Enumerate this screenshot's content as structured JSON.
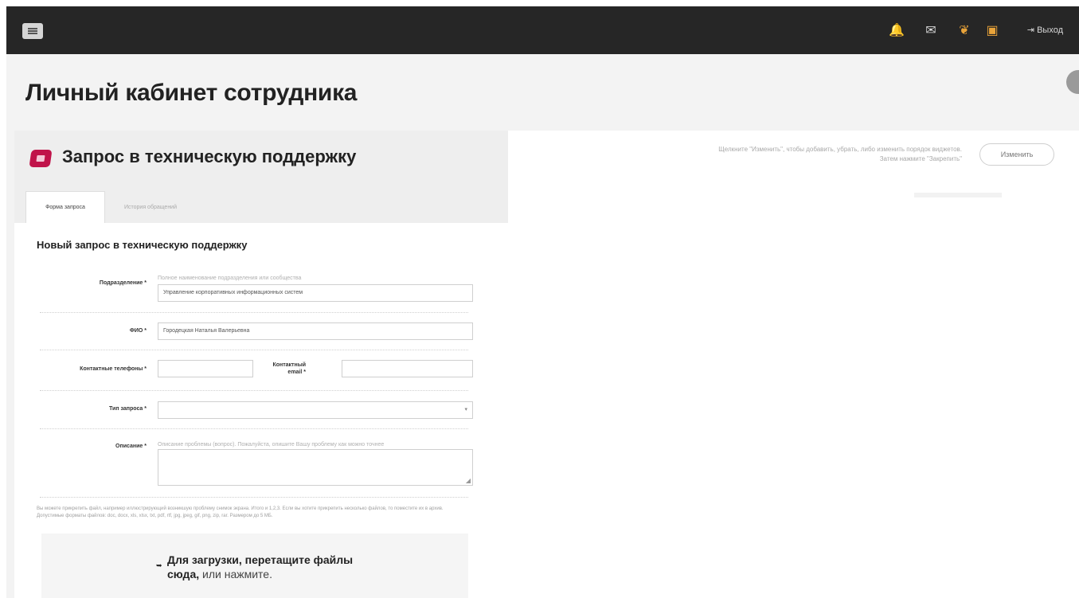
{
  "topbar": {
    "menu_icon": "hamburger-icon",
    "icons": [
      "bell-icon",
      "mail-icon",
      "feedback-icon",
      "news-icon"
    ],
    "icon_glyphs": [
      "🔔",
      "✉",
      "❦",
      "▣"
    ],
    "exit_label": "Выход",
    "exit_glyph": "⇥"
  },
  "page": {
    "title": "Личный кабинет сотрудника"
  },
  "widget": {
    "title": "Запрос в техническую поддержку",
    "tabs": [
      {
        "label": "Форма запроса",
        "active": true
      },
      {
        "label": "История обращений",
        "active": false
      }
    ]
  },
  "form": {
    "title": "Новый запрос в техническую поддержку",
    "department": {
      "label": "Подразделение *",
      "hint": "Полное наименование подразделения или сообщества",
      "value": "Управление корпоративных информационных систем"
    },
    "fio": {
      "label": "ФИО *",
      "value": "Городецкая Наталья Валерьевна"
    },
    "phone": {
      "label": "Контактные телефоны *",
      "value": ""
    },
    "email": {
      "label": "Контактный email *",
      "value": ""
    },
    "request_type": {
      "label": "Тип запроса *",
      "value": "",
      "arrow": "▾"
    },
    "description": {
      "label": "Описание *",
      "hint": "Описание проблемы (вопрос). Пожалуйста, опишите Вашу проблему как можно точнее",
      "value": "",
      "resize_glyph": "◢"
    },
    "upload_note": "Вы можете прикрепить файл, например иллюстрирующий возникшую проблему снимок экрана. Итого и 1,2,3. Если вы хотите прикрепить несколько файлов, то поместите их в архив. Допустимые форматы файлов: doc, docx, xls, xlsx, txt, pdf, rtf, jpg, jpeg, gif, png, zip, rar. Размером до 5 МБ.",
    "dropzone": {
      "icon_glyph": "➥",
      "text": "Для загрузки, перетащите файлы сюда,",
      "link": "или нажмите."
    }
  },
  "right_panel": {
    "hint": "Щелкните \"Изменить\", чтобы добавить, убрать, либо изменить порядок виджетов. Затем нажмите \"Закрепить\"",
    "change_button": "Изменить"
  },
  "colors": {
    "topbar": "#262626",
    "widget_icon": "#c0134a",
    "page_bg": "#f3f3f3"
  }
}
